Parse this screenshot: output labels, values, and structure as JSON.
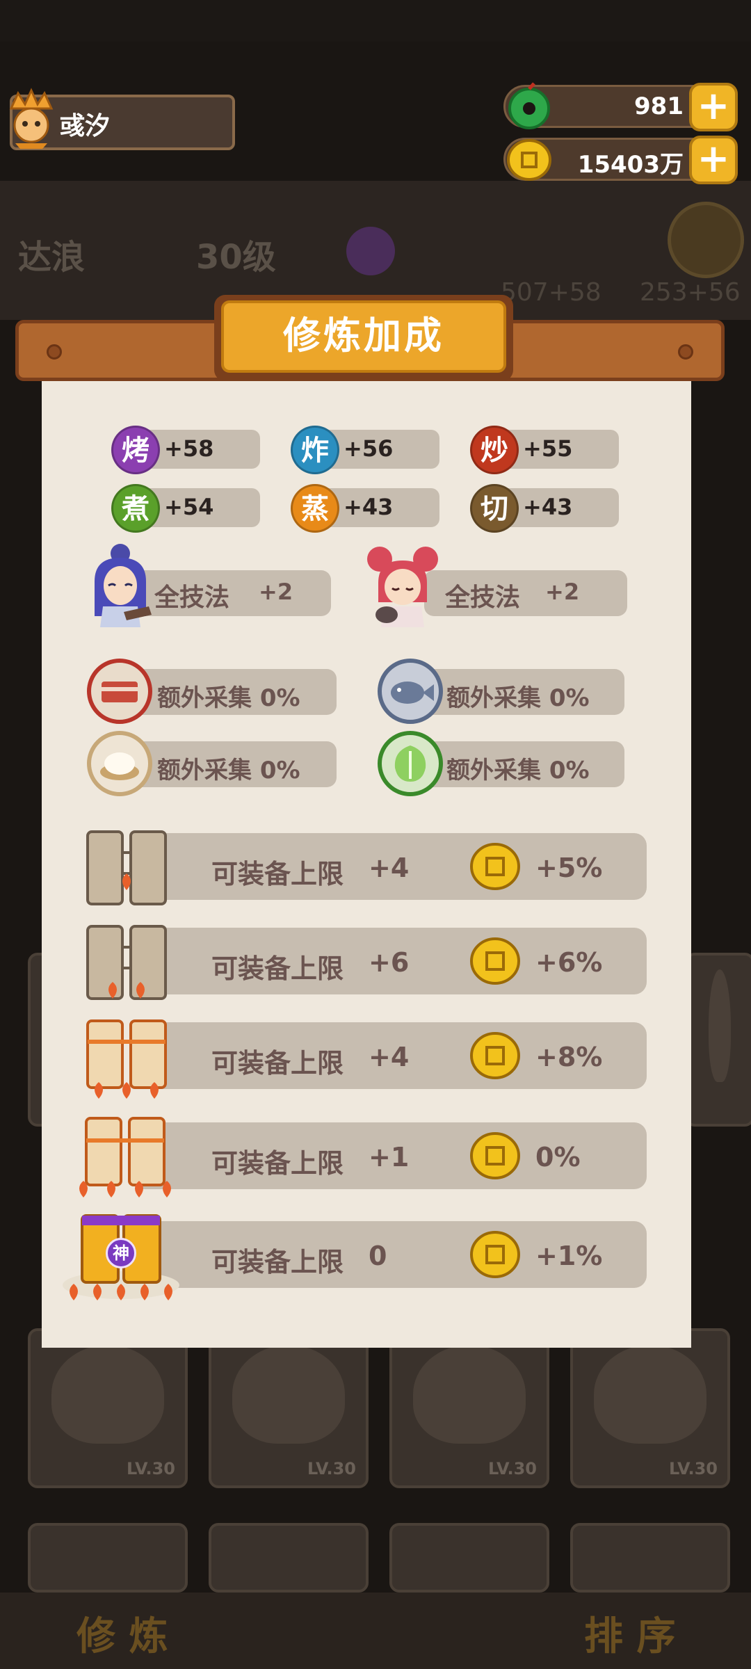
{
  "top_bar": {
    "player_name": "彧汐",
    "jade_value": "981",
    "coin_value": "15403万",
    "plus_symbol": "+"
  },
  "background": {
    "hero_name": "达浪",
    "hero_level": "30级",
    "stat_a": "507+58",
    "stat_b": "253+56",
    "card_levels": [
      "LV.30",
      "LV.30",
      "LV.30",
      "LV.30"
    ],
    "bottom_left": "修 炼",
    "bottom_right": "排 序"
  },
  "dialog": {
    "title": "修炼加成",
    "skills": [
      {
        "label": "烤",
        "value": "+58",
        "color": "#8b3fb0"
      },
      {
        "label": "炸",
        "value": "+56",
        "color": "#2b8fc0"
      },
      {
        "label": "炒",
        "value": "+55",
        "color": "#c0381e"
      },
      {
        "label": "煮",
        "value": "+54",
        "color": "#5aa02a"
      },
      {
        "label": "蒸",
        "value": "+43",
        "color": "#e88a18"
      },
      {
        "label": "切",
        "value": "+43",
        "color": "#7a5a2e"
      }
    ],
    "characters": [
      {
        "label": "全技法",
        "value": "+2"
      },
      {
        "label": "全技法",
        "value": "+2"
      }
    ],
    "gathers": [
      {
        "label": "额外采集 0%",
        "ring": "#b8352a"
      },
      {
        "label": "额外采集 0%",
        "ring": "#5a6a88"
      },
      {
        "label": "额外采集 0%",
        "ring": "#c7a878"
      },
      {
        "label": "额外采集 0%",
        "ring": "#3a8a2a"
      }
    ],
    "equips": [
      {
        "label": "可装备上限",
        "value": "+4",
        "bonus": "+5%"
      },
      {
        "label": "可装备上限",
        "value": "+6",
        "bonus": "+6%"
      },
      {
        "label": "可装备上限",
        "value": "+4",
        "bonus": "+8%"
      },
      {
        "label": "可装备上限",
        "value": "+1",
        "bonus": "0%"
      },
      {
        "label": "可装备上限",
        "value": "0",
        "bonus": "+1%"
      }
    ],
    "legend_badge": "神"
  }
}
